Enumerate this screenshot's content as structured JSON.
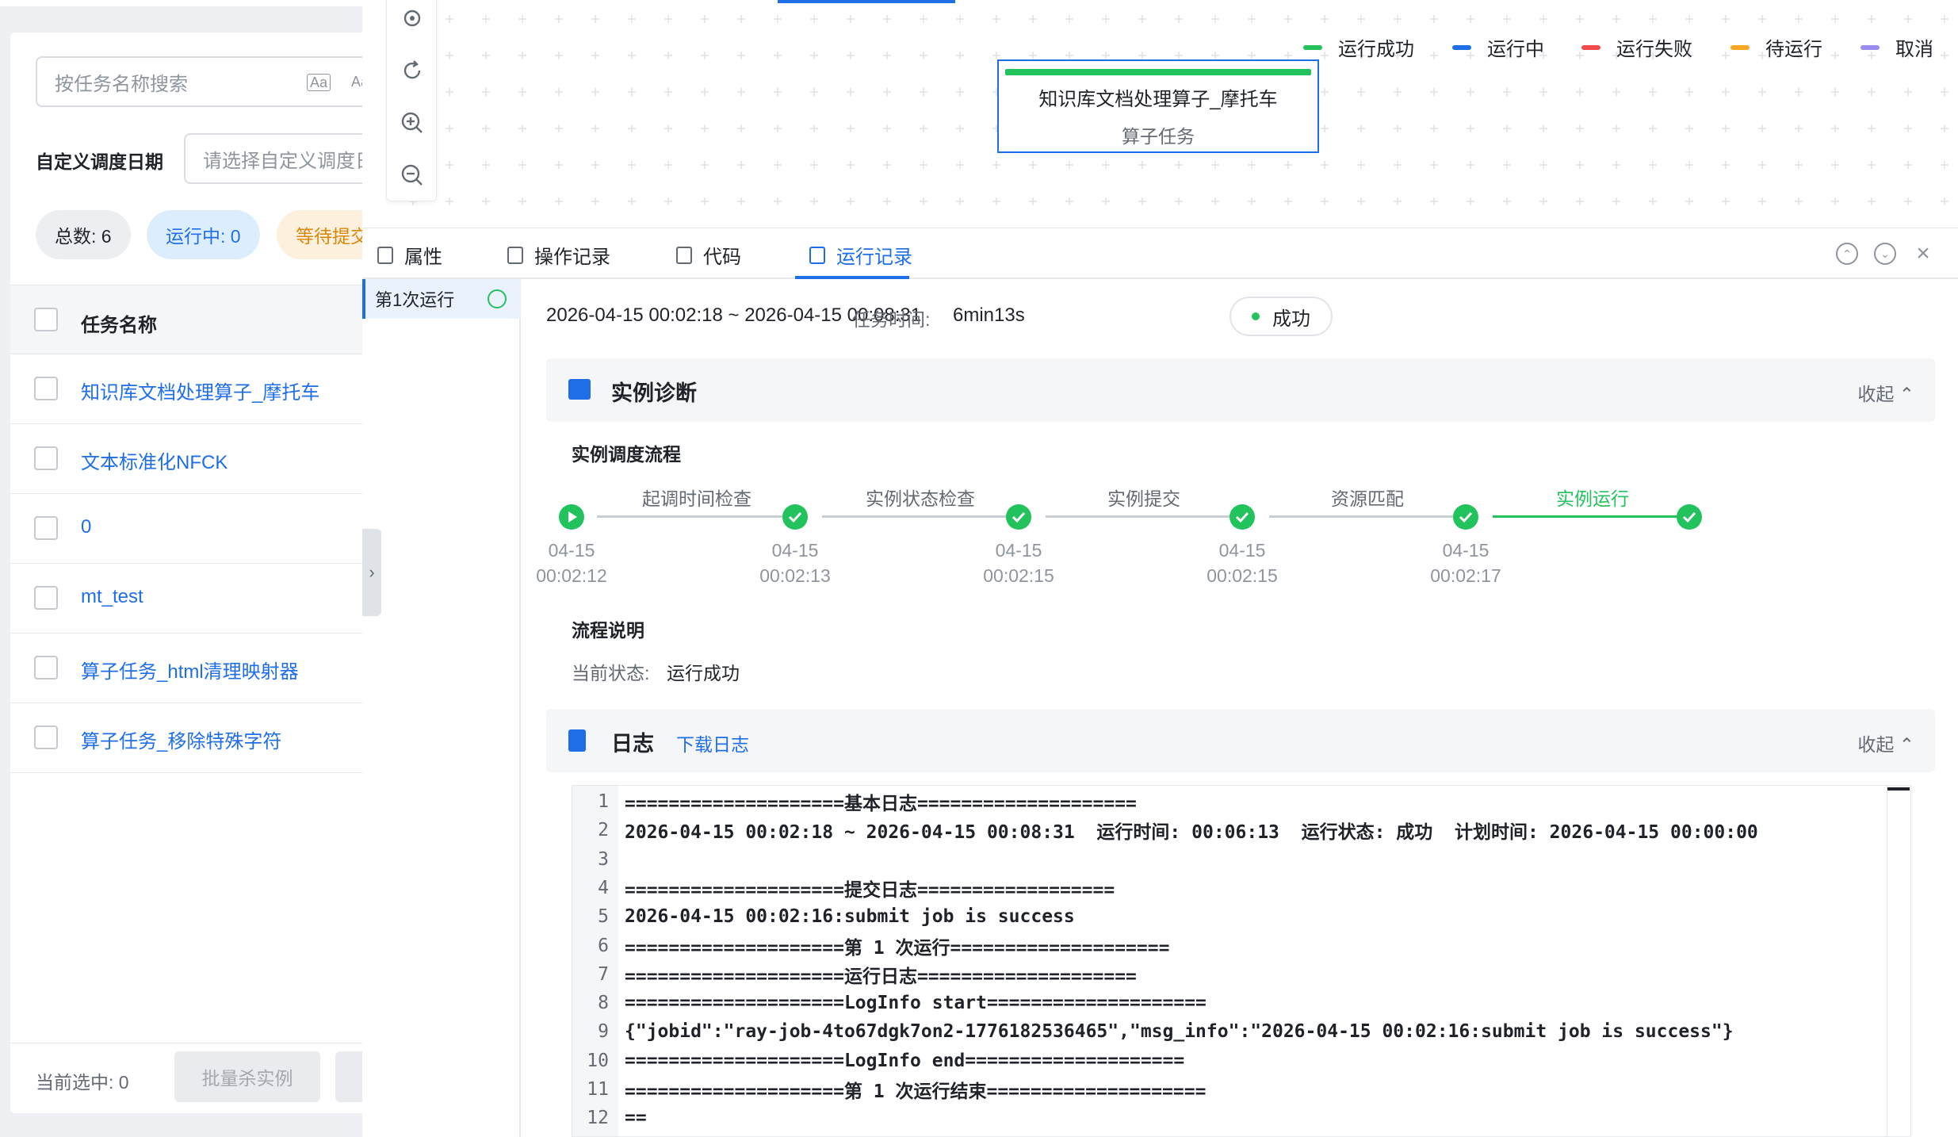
{
  "left": {
    "search_placeholder": "按任务名称搜索",
    "case_toggle": "Aa",
    "date_label": "自定义调度日期",
    "date_placeholder": "请选择自定义调度日期",
    "pills": {
      "total": "总数: 6",
      "running": "运行中: 0",
      "waiting": "等待提交"
    },
    "list_header": "任务名称",
    "tasks": [
      "知识库文档处理算子_摩托车",
      "文本标准化NFCK",
      "0",
      "mt_test",
      "算子任务_html清理映射器",
      "算子任务_移除特殊字符"
    ],
    "selected_count": "当前选中: 0",
    "kill_button": "批量杀实例"
  },
  "canvas": {
    "legend": [
      {
        "label": "运行成功",
        "color": "#22c35d"
      },
      {
        "label": "运行中",
        "color": "#1f6ee8"
      },
      {
        "label": "运行失败",
        "color": "#f04a4a"
      },
      {
        "label": "待运行",
        "color": "#f6a623"
      },
      {
        "label": "取消",
        "color": "#9b8cf0"
      }
    ],
    "node_title": "知识库文档处理算子_摩托车",
    "node_sub": "算子任务"
  },
  "tabs": {
    "items": [
      "属性",
      "操作记录",
      "代码",
      "运行记录"
    ],
    "active": "运行记录"
  },
  "runs": {
    "item": "第1次运行"
  },
  "detail": {
    "time_range": "2026-04-15 00:02:18 ~ 2026-04-15 00:08:31",
    "task_time_label": "任务时间:",
    "task_time_value": "6min13s",
    "status": "成功",
    "diagnosis_title": "实例诊断",
    "collapse_label": "收起",
    "flow_title": "实例调度流程",
    "steps": [
      "起调时间检查",
      "实例状态检查",
      "实例提交",
      "资源匹配",
      "实例运行"
    ],
    "step_dates": [
      "04-15",
      "04-15",
      "04-15",
      "04-15",
      "04-15"
    ],
    "step_times": [
      "00:02:12",
      "00:02:13",
      "00:02:15",
      "00:02:15",
      "00:02:17"
    ],
    "flow_desc_title": "流程说明",
    "current_status_label": "当前状态:",
    "current_status_value": "运行成功",
    "log_title": "日志",
    "download_log": "下载日志",
    "log_lines": [
      "====================基本日志====================",
      "2026-04-15 00:02:18 ~ 2026-04-15 00:08:31  运行时间: 00:06:13  运行状态: 成功  计划时间: 2026-04-15 00:00:00",
      "",
      "====================提交日志==================",
      "2026-04-15 00:02:16:submit job is success",
      "====================第 1 次运行====================",
      "====================运行日志====================",
      "====================LogInfo start====================",
      "{\"jobid\":\"ray-job-4to67dgk7on2-1776182536465\",\"msg_info\":\"2026-04-15 00:02:16:submit job is success\"}",
      "====================LogInfo end====================",
      "====================第 1 次运行结束====================",
      "=="
    ]
  }
}
